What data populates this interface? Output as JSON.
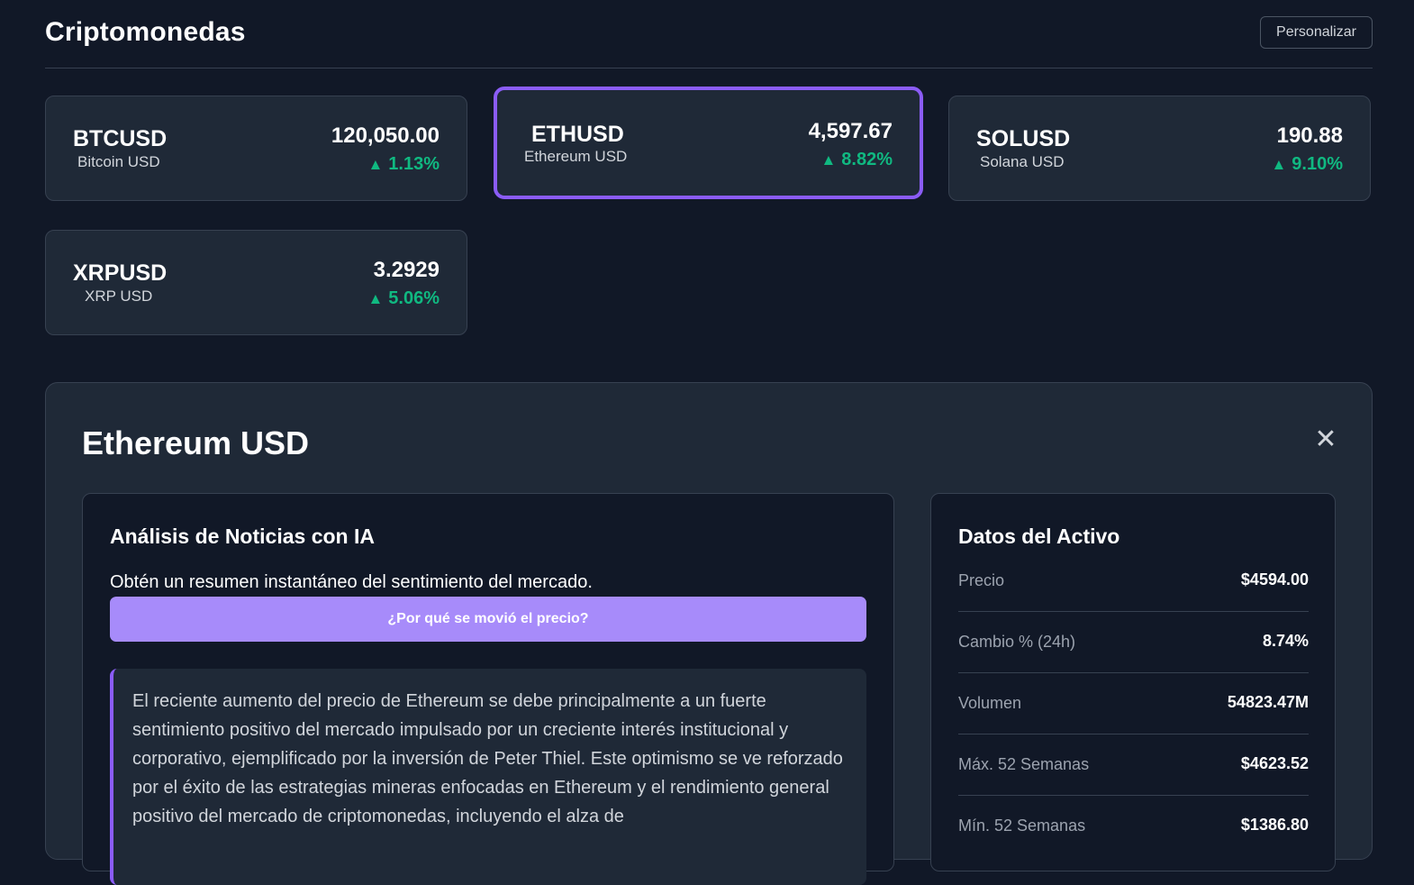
{
  "header": {
    "title": "Criptomonedas",
    "personalize_label": "Personalizar"
  },
  "colors": {
    "background": "#111827",
    "card": "#1f2937",
    "accent": "#8b5cf6",
    "button": "#a78bfa",
    "positive": "#10b981"
  },
  "cards": [
    {
      "symbol": "BTCUSD",
      "name": "Bitcoin USD",
      "price": "120,050.00",
      "change": "1.13%",
      "direction": "up",
      "selected": false
    },
    {
      "symbol": "ETHUSD",
      "name": "Ethereum USD",
      "price": "4,597.67",
      "change": "8.82%",
      "direction": "up",
      "selected": true
    },
    {
      "symbol": "SOLUSD",
      "name": "Solana USD",
      "price": "190.88",
      "change": "9.10%",
      "direction": "up",
      "selected": false
    },
    {
      "symbol": "XRPUSD",
      "name": "XRP USD",
      "price": "3.2929",
      "change": "5.06%",
      "direction": "up",
      "selected": false
    }
  ],
  "change_icon": "triangle-up-icon",
  "detail": {
    "title": "Ethereum USD",
    "close_icon": "close-icon",
    "news": {
      "title": "Análisis de Noticias con IA",
      "subtitle": "Obtén un resumen instantáneo del sentimiento del mercado.",
      "button_label": "¿Por qué se movió el precio?",
      "analysis": "El reciente aumento del precio de Ethereum se debe principalmente a un fuerte sentimiento positivo del mercado impulsado por un creciente interés institucional y corporativo, ejemplificado por la inversión de Peter Thiel. Este optimismo se ve reforzado por el éxito de las estrategias mineras enfocadas en Ethereum y el rendimiento general positivo del mercado de criptomonedas, incluyendo el alza de"
    },
    "asset": {
      "title": "Datos del Activo",
      "rows": [
        {
          "label": "Precio",
          "value": "$4594.00"
        },
        {
          "label": "Cambio % (24h)",
          "value": "8.74%"
        },
        {
          "label": "Volumen",
          "value": "54823.47M"
        },
        {
          "label": "Máx. 52 Semanas",
          "value": "$4623.52"
        },
        {
          "label": "Mín. 52 Semanas",
          "value": "$1386.80"
        }
      ]
    }
  }
}
